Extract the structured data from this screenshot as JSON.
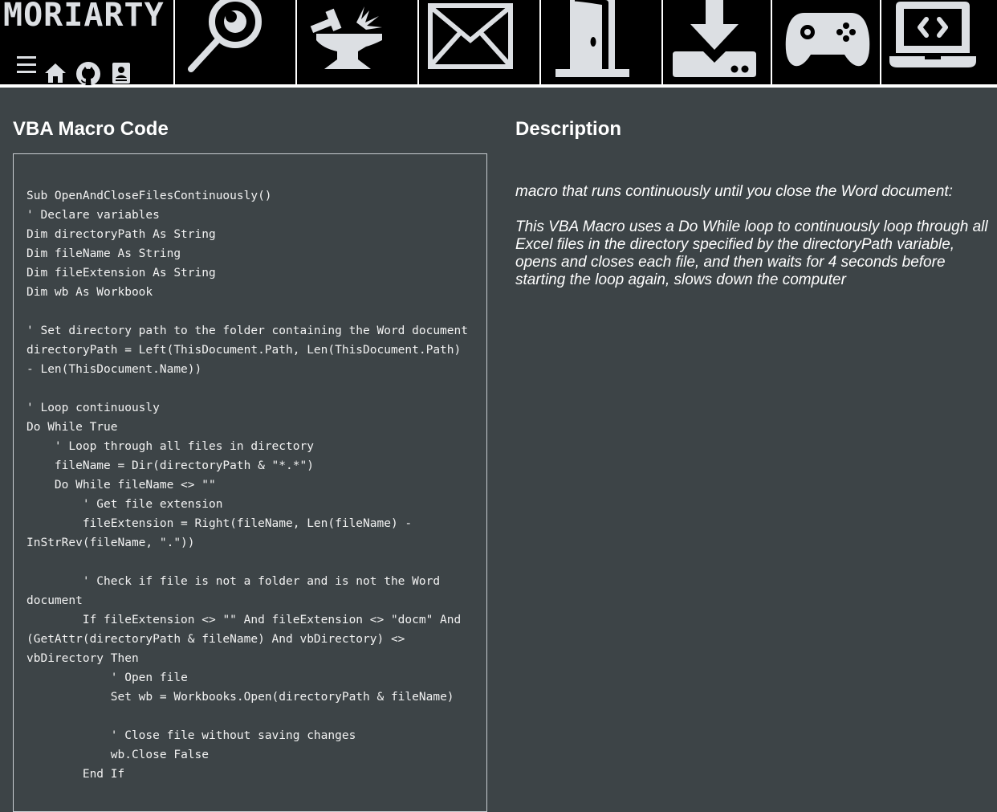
{
  "brand": {
    "logo_text": "MORIARTY"
  },
  "nav": {
    "icons": [
      "menu-icon",
      "home-icon",
      "github-icon",
      "contact-icon",
      "magnifier-icon",
      "anvil-icon",
      "envelope-icon",
      "door-icon",
      "download-icon",
      "gamepad-icon",
      "laptop-code-icon"
    ]
  },
  "colors": {
    "page_background": "#3d4447",
    "topbar_background": "#000000",
    "icon": "#dcdfe3",
    "text": "#ffffff"
  },
  "code_section": {
    "title": "VBA Macro Code",
    "code": "Sub OpenAndCloseFilesContinuously()\n' Declare variables\nDim directoryPath As String\nDim fileName As String\nDim fileExtension As String\nDim wb As Workbook\n\n' Set directory path to the folder containing the Word document\ndirectoryPath = Left(ThisDocument.Path, Len(ThisDocument.Path) - Len(ThisDocument.Name))\n\n' Loop continuously\nDo While True\n    ' Loop through all files in directory\n    fileName = Dir(directoryPath & \"*.*\")\n    Do While fileName <> \"\"\n        ' Get file extension\n        fileExtension = Right(fileName, Len(fileName) - InStrRev(fileName, \".\"))\n\n        ' Check if file is not a folder and is not the Word document\n        If fileExtension <> \"\" And fileExtension <> \"docm\" And (GetAttr(directoryPath & fileName) And vbDirectory) <> vbDirectory Then\n            ' Open file\n            Set wb = Workbooks.Open(directoryPath & fileName)\n\n            ' Close file without saving changes\n            wb.Close False\n        End If"
  },
  "description_section": {
    "title": "Description",
    "intro": "macro that runs continuously until you close the Word document:",
    "body": "This VBA Macro uses a Do While loop to continuously loop through all Excel files in the directory specified by the directoryPath variable, opens and closes each file, and then waits for 4 seconds before starting the loop again, slows down the computer"
  }
}
